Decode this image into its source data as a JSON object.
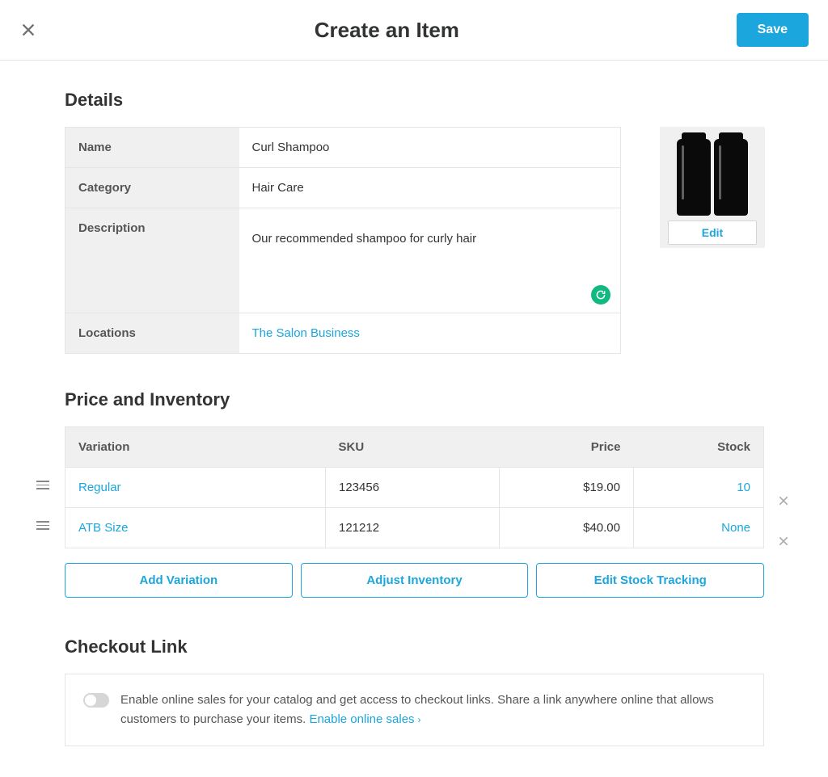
{
  "header": {
    "title": "Create an Item",
    "save_label": "Save"
  },
  "details": {
    "section_title": "Details",
    "labels": {
      "name": "Name",
      "category": "Category",
      "description": "Description",
      "locations": "Locations"
    },
    "values": {
      "name": "Curl Shampoo",
      "category": "Hair Care",
      "description": "Our recommended shampoo for curly hair",
      "locations": "The Salon Business"
    },
    "image_edit_label": "Edit"
  },
  "price_inventory": {
    "section_title": "Price and Inventory",
    "columns": {
      "variation": "Variation",
      "sku": "SKU",
      "price": "Price",
      "stock": "Stock"
    },
    "rows": [
      {
        "variation": "Regular",
        "sku": "123456",
        "price": "$19.00",
        "stock": "10"
      },
      {
        "variation": "ATB Size",
        "sku": "121212",
        "price": "$40.00",
        "stock": "None"
      }
    ],
    "actions": {
      "add_variation": "Add Variation",
      "adjust_inventory": "Adjust Inventory",
      "edit_stock_tracking": "Edit Stock Tracking"
    }
  },
  "checkout": {
    "section_title": "Checkout Link",
    "text": "Enable online sales for your catalog and get access to checkout links. Share a link anywhere online that allows customers to purchase your items. ",
    "link_label": "Enable online sales"
  }
}
